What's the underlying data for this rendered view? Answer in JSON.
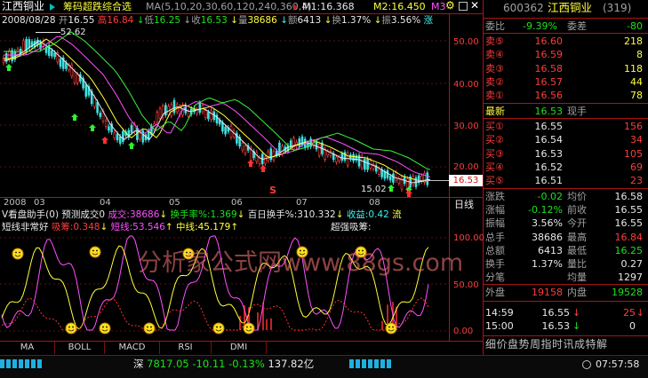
{
  "stock": {
    "name": "江西铜业",
    "code": "600362",
    "name_right": "江西铜业",
    "count": "(319)"
  },
  "info_line": {
    "date": "2008/08/28",
    "open_lbl": "开",
    "open": "16.55",
    "high_lbl": "高",
    "high": "16.84",
    "low_lbl": "低",
    "low": "16.25",
    "close_lbl": "收",
    "close": "16.53",
    "vol_lbl": "量",
    "vol": "38686",
    "amt_lbl": "额",
    "amt": "6413",
    "turn_lbl": "换",
    "turn": "1.37%",
    "amp_lbl": "振",
    "amp": "3.56%",
    "rise_lbl": "涨"
  },
  "indicator_line": {
    "name": "筹码超跌综合选",
    "ma_params": "MA(5,10,20,30,60,120,240,360,4)",
    "m1": "M1:16.368",
    "m2": "M2:16.450",
    "m3": "M3"
  },
  "price_axis": [
    "50.00",
    "40.00",
    "30.00",
    "20.00"
  ],
  "price_marks": {
    "high": "52.62",
    "low": "15.02",
    "current": "16.53",
    "s1": "S",
    "s2": "S"
  },
  "date_axis": [
    "2008",
    "03",
    "04",
    "05",
    "06",
    "07",
    "08"
  ],
  "daily_label": "日线",
  "sub_header": {
    "title": "V看盘助手(0)",
    "forecast": "预测成交0",
    "vol": "成交:38686",
    "turn": "换手率%:1.369",
    "hundred": "百日换手%:310.332",
    "profit": "收益:0.42",
    "flow": "流"
  },
  "sub_line2": {
    "short_bad": "短线非常好",
    "suck": "吸筹:0.348",
    "short": "短线:53.546",
    "mid": "中线:45.179",
    "super": "超强吸筹:"
  },
  "sub_axis": [
    "100.00",
    "50.00",
    "0.00"
  ],
  "watermark": "分析家公式网www.88gs.com",
  "tabs": [
    "MA",
    "BOLL",
    "MACD",
    "RSI",
    "DMI"
  ],
  "bottom": {
    "index_name": "深",
    "index": "7817.05",
    "chg": "-10.11",
    "pct": "-0.13%",
    "amount": "137.82亿",
    "time": "07:57:58"
  },
  "quote": {
    "ratio_lbl": "委比",
    "ratio": "-9.39%",
    "diff_lbl": "委差",
    "diff": "-80",
    "sells": [
      {
        "l": "卖⑤",
        "p": "16.60",
        "v": "218"
      },
      {
        "l": "卖④",
        "p": "16.59",
        "v": "8"
      },
      {
        "l": "卖③",
        "p": "16.58",
        "v": "118"
      },
      {
        "l": "卖②",
        "p": "16.57",
        "v": "44"
      },
      {
        "l": "卖①",
        "p": "16.56",
        "v": "78"
      }
    ],
    "last_lbl": "最新",
    "last": "16.53",
    "last_hand": "现手",
    "buys": [
      {
        "l": "买①",
        "p": "16.55",
        "v": "156"
      },
      {
        "l": "买②",
        "p": "16.54",
        "v": "34"
      },
      {
        "l": "买③",
        "p": "16.53",
        "v": "105"
      },
      {
        "l": "买④",
        "p": "16.52",
        "v": "69"
      },
      {
        "l": "买⑤",
        "p": "16.51",
        "v": "23"
      }
    ],
    "stats": [
      {
        "l1": "涨跌",
        "v1": "-0.02",
        "l2": "均价",
        "v2": "16.58"
      },
      {
        "l1": "涨幅",
        "v1": "-0.12%",
        "l2": "前收",
        "v2": "16.55"
      },
      {
        "l1": "振幅",
        "v1": "3.56%",
        "l2": "今开",
        "v2": "16.55"
      },
      {
        "l1": "总手",
        "v1": "38686",
        "l2": "最高",
        "v2": "16.84"
      },
      {
        "l1": "总额",
        "v1": "6413",
        "l2": "最低",
        "v2": "16.25"
      },
      {
        "l1": "换手",
        "v1": "1.37%",
        "l2": "量比",
        "v2": "0.27"
      },
      {
        "l1": "分笔",
        "v1": "",
        "l2": "均量",
        "v2": "1297"
      }
    ],
    "outer_lbl": "外盘",
    "outer": "19158",
    "inner_lbl": "内盘",
    "inner": "19528",
    "ticks": [
      {
        "t": "14:59",
        "p": "16.55",
        "v": "25"
      },
      {
        "t": "15:00",
        "p": "16.53",
        "v": "0"
      }
    ],
    "bottom_tabs": "细价盘势周指时讯成特解"
  }
}
